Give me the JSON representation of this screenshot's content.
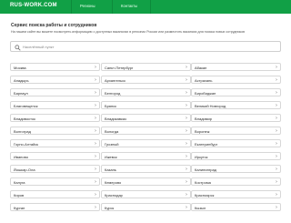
{
  "header": {
    "logo": "RUS-WORK.COM",
    "nav": [
      "Регионы",
      "Контакты"
    ],
    "brand_color": "#11a046"
  },
  "main": {
    "title": "Сервис поиска работы и сотрудников",
    "subtitle": "На нашем сайте вы можете посмотреть информацию о доступных вакансиях в регионах России или разместить вакансии для поиска новых сотрудников"
  },
  "search": {
    "placeholder": "Населённый пункт",
    "value": ""
  },
  "cities": {
    "col1": [
      "Москва",
      "Анадырь",
      "Барнаул",
      "Благовещенск",
      "Владивосток",
      "Волгоград",
      "Горно-Алтайск",
      "Иваново",
      "Йошкар-Ола",
      "Калуга",
      "Киров",
      "Курган"
    ],
    "col2": [
      "Санкт-Петербург",
      "Архангельск",
      "Белгород",
      "Брянск",
      "Владикавказ",
      "Вологда",
      "Грозный",
      "Ижевск",
      "Казань",
      "Кемерово",
      "Краснодар",
      "Курск"
    ],
    "col3": [
      "Абакан",
      "Астрахань",
      "Биробиджан",
      "Великий Новгород",
      "Владимир",
      "Воронеж",
      "Екатеринбург",
      "Иркутск",
      "Калининград",
      "Кострома",
      "Красноярск",
      "Кызыл"
    ]
  }
}
